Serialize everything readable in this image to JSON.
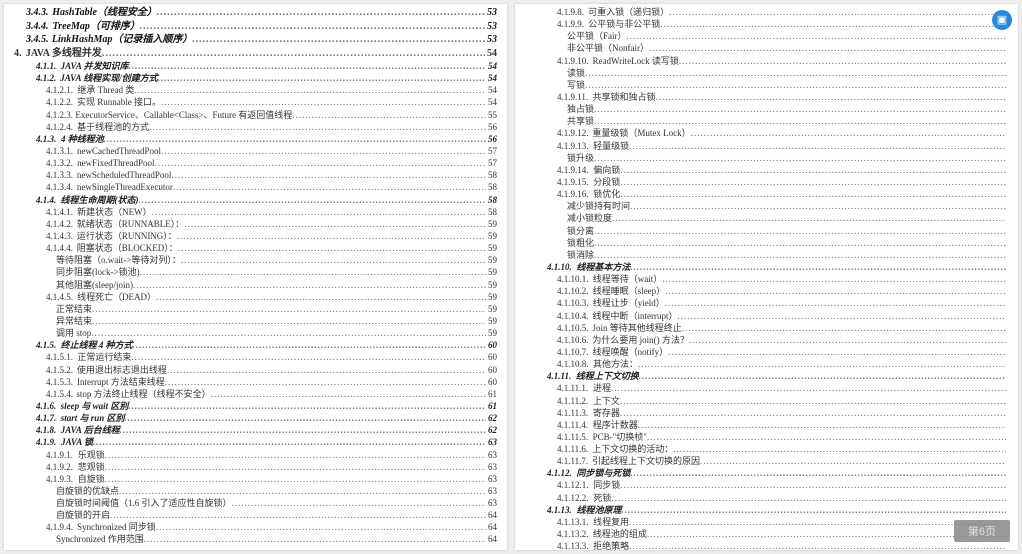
{
  "badge": "▣",
  "page_button": "第6页",
  "left": [
    {
      "lvl": "l1",
      "num": "3.4.3.",
      "title": "HashTable（线程安全）",
      "page": "53"
    },
    {
      "lvl": "l1",
      "num": "3.4.4.",
      "title": "TreeMap（可排序）",
      "page": "53"
    },
    {
      "lvl": "l1",
      "num": "3.4.5.",
      "title": "LinkHashMap（记录插入顺序）",
      "page": "53"
    },
    {
      "lvl": "chap",
      "num": "4.",
      "title": "JAVA 多线程并发",
      "page": "54"
    },
    {
      "lvl": "l2",
      "num": "4.1.1.",
      "title": "JAVA 并发知识库",
      "page": "54"
    },
    {
      "lvl": "l2",
      "num": "4.1.2.",
      "title": "JAVA 线程实现/创建方式",
      "page": "54"
    },
    {
      "lvl": "l4",
      "num": "4.1.2.1.",
      "title": "继承 Thread 类",
      "page": "54"
    },
    {
      "lvl": "l4",
      "num": "4.1.2.2.",
      "title": "实现 Runnable 接口。",
      "page": "54"
    },
    {
      "lvl": "l4",
      "num": "4.1.2.3.",
      "title": "ExecutorService、Callable<Class>、Future 有返回值线程",
      "page": "55"
    },
    {
      "lvl": "l4",
      "num": "4.1.2.4.",
      "title": "基于线程池的方式",
      "page": "56"
    },
    {
      "lvl": "l2",
      "num": "4.1.3.",
      "title": "4 种线程池",
      "page": "56"
    },
    {
      "lvl": "l4",
      "num": "4.1.3.1.",
      "title": "newCachedThreadPool",
      "page": "57"
    },
    {
      "lvl": "l4",
      "num": "4.1.3.2.",
      "title": "newFixedThreadPool",
      "page": "57"
    },
    {
      "lvl": "l4",
      "num": "4.1.3.3.",
      "title": "newScheduledThreadPool",
      "page": "58"
    },
    {
      "lvl": "l4",
      "num": "4.1.3.4.",
      "title": "newSingleThreadExecutor",
      "page": "58"
    },
    {
      "lvl": "l2",
      "num": "4.1.4.",
      "title": "线程生命周期(状态)",
      "page": "58"
    },
    {
      "lvl": "l4",
      "num": "4.1.4.1.",
      "title": "新建状态（NEW）",
      "page": "58"
    },
    {
      "lvl": "l4",
      "num": "4.1.4.2.",
      "title": "就绪状态（RUNNABLE）：",
      "page": "59"
    },
    {
      "lvl": "l4",
      "num": "4.1.4.3.",
      "title": "运行状态（RUNNING）：",
      "page": "59"
    },
    {
      "lvl": "l4",
      "num": "4.1.4.4.",
      "title": "阻塞状态（BLOCKED）：",
      "page": "59"
    },
    {
      "lvl": "l5",
      "num": "",
      "title": "等待阻塞（o.wait->等待对列）：",
      "page": "59"
    },
    {
      "lvl": "l5",
      "num": "",
      "title": "同步阻塞(lock->锁池)",
      "page": "59"
    },
    {
      "lvl": "l5",
      "num": "",
      "title": "其他阻塞(sleep/join)",
      "page": "59"
    },
    {
      "lvl": "l4",
      "num": "4.1.4.5.",
      "title": "线程死亡（DEAD）",
      "page": "59"
    },
    {
      "lvl": "l5",
      "num": "",
      "title": "正常结束",
      "page": "59"
    },
    {
      "lvl": "l5",
      "num": "",
      "title": "异常结束",
      "page": "59"
    },
    {
      "lvl": "l5",
      "num": "",
      "title": "调用 stop",
      "page": "59"
    },
    {
      "lvl": "l2",
      "num": "4.1.5.",
      "title": "终止线程 4 种方式",
      "page": "60"
    },
    {
      "lvl": "l4",
      "num": "4.1.5.1.",
      "title": "正常运行结束",
      "page": "60"
    },
    {
      "lvl": "l4",
      "num": "4.1.5.2.",
      "title": "使用退出标志退出线程",
      "page": "60"
    },
    {
      "lvl": "l4",
      "num": "4.1.5.3.",
      "title": "Interrupt 方法结束线程",
      "page": "60"
    },
    {
      "lvl": "l4",
      "num": "4.1.5.4.",
      "title": "stop 方法终止线程（线程不安全）",
      "page": "61"
    },
    {
      "lvl": "l2",
      "num": "4.1.6.",
      "title": "sleep 与 wait 区别",
      "page": "61"
    },
    {
      "lvl": "l2",
      "num": "4.1.7.",
      "title": "start 与 run 区别",
      "page": "62"
    },
    {
      "lvl": "l2",
      "num": "4.1.8.",
      "title": "JAVA 后台线程",
      "page": "62"
    },
    {
      "lvl": "l2",
      "num": "4.1.9.",
      "title": "JAVA 锁",
      "page": "63"
    },
    {
      "lvl": "l4",
      "num": "4.1.9.1.",
      "title": "乐观锁",
      "page": "63"
    },
    {
      "lvl": "l4",
      "num": "4.1.9.2.",
      "title": "悲观锁",
      "page": "63"
    },
    {
      "lvl": "l4",
      "num": "4.1.9.3.",
      "title": "自旋锁",
      "page": "63"
    },
    {
      "lvl": "l5",
      "num": "",
      "title": "自旋锁的优缺点",
      "page": "63"
    },
    {
      "lvl": "l5",
      "num": "",
      "title": "自旋锁时间阈值（1.6 引入了适应性自旋锁）",
      "page": "63"
    },
    {
      "lvl": "l5",
      "num": "",
      "title": "自旋锁的开启",
      "page": "64"
    },
    {
      "lvl": "l4",
      "num": "4.1.9.4.",
      "title": "Synchronized 同步锁",
      "page": "64"
    },
    {
      "lvl": "l5",
      "num": "",
      "title": "Synchronized 作用范围",
      "page": "64"
    }
  ],
  "right": [
    {
      "lvl": "l4",
      "num": "4.1.9.8.",
      "title": "可重入锁（递归锁）",
      "page": ""
    },
    {
      "lvl": "l4",
      "num": "4.1.9.9.",
      "title": "公平锁与非公平锁",
      "page": ""
    },
    {
      "lvl": "l5",
      "num": "",
      "title": "公平锁（Fair）",
      "page": ""
    },
    {
      "lvl": "l5",
      "num": "",
      "title": "非公平锁（Nonfair）",
      "page": ""
    },
    {
      "lvl": "l4",
      "num": "4.1.9.10.",
      "title": "ReadWriteLock 读写锁",
      "page": ""
    },
    {
      "lvl": "l5",
      "num": "",
      "title": "读锁",
      "page": ""
    },
    {
      "lvl": "l5",
      "num": "",
      "title": "写锁",
      "page": ""
    },
    {
      "lvl": "l4",
      "num": "4.1.9.11.",
      "title": "共享锁和独占锁",
      "page": ""
    },
    {
      "lvl": "l5",
      "num": "",
      "title": "独占锁",
      "page": ""
    },
    {
      "lvl": "l5",
      "num": "",
      "title": "共享锁",
      "page": ""
    },
    {
      "lvl": "l4",
      "num": "4.1.9.12.",
      "title": "重量级锁（Mutex Lock）",
      "page": ""
    },
    {
      "lvl": "l4",
      "num": "4.1.9.13.",
      "title": "轻量级锁",
      "page": ""
    },
    {
      "lvl": "l5",
      "num": "",
      "title": "锁升级",
      "page": ""
    },
    {
      "lvl": "l4",
      "num": "4.1.9.14.",
      "title": "偏向锁",
      "page": ""
    },
    {
      "lvl": "l4",
      "num": "4.1.9.15.",
      "title": "分段锁",
      "page": ""
    },
    {
      "lvl": "l4",
      "num": "4.1.9.16.",
      "title": "锁优化",
      "page": ""
    },
    {
      "lvl": "l5",
      "num": "",
      "title": "减少锁持有时间",
      "page": ""
    },
    {
      "lvl": "l5",
      "num": "",
      "title": "减小锁粒度",
      "page": ""
    },
    {
      "lvl": "l5",
      "num": "",
      "title": "锁分离",
      "page": ""
    },
    {
      "lvl": "l5",
      "num": "",
      "title": "锁粗化",
      "page": ""
    },
    {
      "lvl": "l5",
      "num": "",
      "title": "锁消除",
      "page": ""
    },
    {
      "lvl": "l2",
      "num": "4.1.10.",
      "title": "线程基本方法",
      "page": ""
    },
    {
      "lvl": "l4",
      "num": "4.1.10.1.",
      "title": "线程等待（wait）",
      "page": ""
    },
    {
      "lvl": "l4",
      "num": "4.1.10.2.",
      "title": "线程睡眠（sleep）",
      "page": ""
    },
    {
      "lvl": "l4",
      "num": "4.1.10.3.",
      "title": "线程让步（yield）",
      "page": ""
    },
    {
      "lvl": "l4",
      "num": "4.1.10.4.",
      "title": "线程中断（interrupt）",
      "page": ""
    },
    {
      "lvl": "l4",
      "num": "4.1.10.5.",
      "title": "Join 等待其他线程终止",
      "page": ""
    },
    {
      "lvl": "l4",
      "num": "4.1.10.6.",
      "title": "为什么要用 join() 方法？",
      "page": ""
    },
    {
      "lvl": "l4",
      "num": "4.1.10.7.",
      "title": "线程唤醒（notify）",
      "page": ""
    },
    {
      "lvl": "l4",
      "num": "4.1.10.8.",
      "title": "其他方法：",
      "page": ""
    },
    {
      "lvl": "l2",
      "num": "4.1.11.",
      "title": "线程上下文切换",
      "page": ""
    },
    {
      "lvl": "l4",
      "num": "4.1.11.1.",
      "title": "进程",
      "page": ""
    },
    {
      "lvl": "l4",
      "num": "4.1.11.2.",
      "title": "上下文",
      "page": ""
    },
    {
      "lvl": "l4",
      "num": "4.1.11.3.",
      "title": "寄存器",
      "page": ""
    },
    {
      "lvl": "l4",
      "num": "4.1.11.4.",
      "title": "程序计数器",
      "page": ""
    },
    {
      "lvl": "l4",
      "num": "4.1.11.5.",
      "title": "PCB-\"切换桢\"",
      "page": ""
    },
    {
      "lvl": "l4",
      "num": "4.1.11.6.",
      "title": "上下文切换的活动：",
      "page": ""
    },
    {
      "lvl": "l4",
      "num": "4.1.11.7.",
      "title": "引起线程上下文切换的原因",
      "page": ""
    },
    {
      "lvl": "l2",
      "num": "4.1.12.",
      "title": "同步锁与死锁",
      "page": ""
    },
    {
      "lvl": "l4",
      "num": "4.1.12.1.",
      "title": "同步锁",
      "page": ""
    },
    {
      "lvl": "l4",
      "num": "4.1.12.2.",
      "title": "死锁",
      "page": ""
    },
    {
      "lvl": "l2",
      "num": "4.1.13.",
      "title": "线程池原理",
      "page": ""
    },
    {
      "lvl": "l4",
      "num": "4.1.13.1.",
      "title": "线程复用",
      "page": ""
    },
    {
      "lvl": "l4",
      "num": "4.1.13.2.",
      "title": "线程池的组成",
      "page": ""
    },
    {
      "lvl": "l4",
      "num": "4.1.13.3.",
      "title": "拒绝策略",
      "page": ""
    }
  ]
}
